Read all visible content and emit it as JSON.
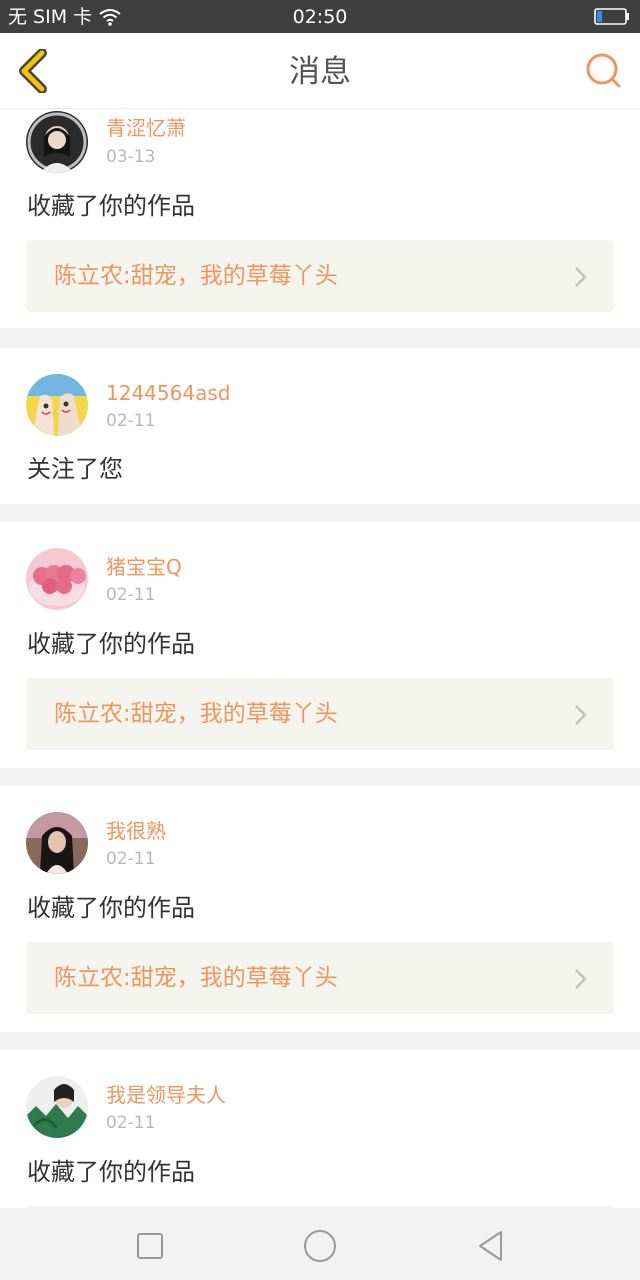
{
  "status_bar": {
    "carrier": "无 SIM 卡",
    "time": "02:50",
    "icons": [
      "wifi-icon",
      "battery-icon"
    ]
  },
  "header": {
    "title": "消息",
    "back_icon": "chevron-left-icon",
    "search_icon": "search-icon"
  },
  "colors": {
    "accent": "#f0955c",
    "back_icon": "#f2c300",
    "text": "#333333",
    "muted": "#b9b9b9",
    "link_bg": "#f5f5f0"
  },
  "messages": [
    {
      "user": "青涩忆萧",
      "date": "03-13",
      "action": "收藏了你的作品",
      "work": "陈立农:甜宠，我的草莓丫头"
    },
    {
      "user": "1244564asd",
      "date": "02-11",
      "action": "关注了您"
    },
    {
      "user": "猪宝宝Q",
      "date": "02-11",
      "action": "收藏了你的作品",
      "work": "陈立农:甜宠，我的草莓丫头"
    },
    {
      "user": "我很熟",
      "date": "02-11",
      "action": "收藏了你的作品",
      "work": "陈立农:甜宠，我的草莓丫头"
    },
    {
      "user": "我是领导夫人",
      "date": "02-11",
      "action": "收藏了你的作品"
    }
  ],
  "nav_bar": {
    "icons": [
      "recent-apps-icon",
      "home-icon",
      "back-triangle-icon"
    ]
  }
}
